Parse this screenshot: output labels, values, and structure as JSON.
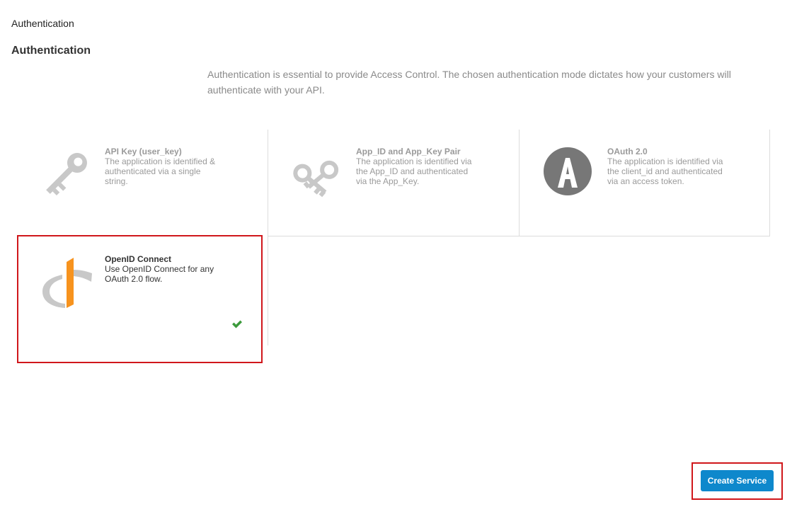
{
  "breadcrumb": "Authentication",
  "section": {
    "title": "Authentication",
    "intro": "Authentication is essential to provide Access Control. The chosen authentication mode dictates how your customers will authenticate with your API."
  },
  "options": [
    {
      "name": "API Key (user_key)",
      "description": "The application is identified & authenticated via a single string.",
      "icon": "key-icon",
      "state": "disabled"
    },
    {
      "name": "App_ID and App_Key Pair",
      "description": "The application is identified via the App_ID and authenticated via the App_Key.",
      "icon": "key-pair-icon",
      "state": "disabled"
    },
    {
      "name": "OAuth 2.0",
      "description": "The application is identified via the client_id and authenticated via an access token.",
      "icon": "oauth-icon",
      "state": "disabled"
    },
    {
      "name": "OpenID Connect",
      "description": "Use OpenID Connect for any OAuth 2.0 flow.",
      "icon": "openid-icon",
      "state": "selected"
    }
  ],
  "actions": {
    "create_label": "Create Service"
  },
  "colors": {
    "accent": "#0e88cc",
    "highlight": "#d0171b",
    "check": "#3c9a3c",
    "openid_orange": "#f7931e",
    "icon_gray": "#c8c8c8"
  }
}
